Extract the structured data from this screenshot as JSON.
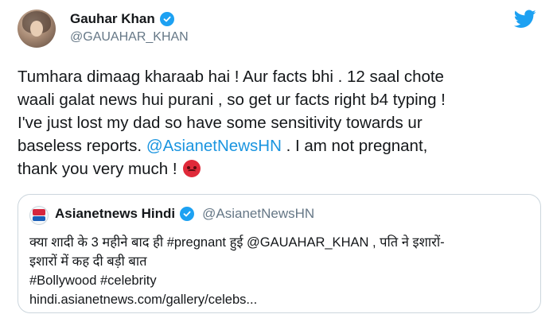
{
  "tweet": {
    "display_name": "Gauhar Khan",
    "handle": "@GAUAHAR_KHAN",
    "body_part1": "Tumhara dimaag kharaab hai ! Aur facts bhi . 12 saal chote\nwaali galat news hui purani , so get ur facts right b4 typing !\nI've just lost my dad so have some sensitivity towards ur\nbaseless reports. ",
    "body_mention": "@AsianetNewsHN",
    "body_part2": " . I am not pregnant,\nthank you very much ! ",
    "emoji_icon": "angry-face-icon"
  },
  "quote": {
    "display_name": "Asianetnews Hindi",
    "handle": "@AsianetNewsHN",
    "line1": "क्या शादी के 3 महीने बाद ही #pregnant  हुई @GAUAHAR_KHAN , पति ने इशारों-",
    "line2": "इशारों में कह दी बड़ी बात",
    "line3": "#Bollywood #celebrity",
    "line4": " hindi.asianetnews.com/gallery/celebs..."
  },
  "colors": {
    "twitter_blue": "#1da1f2",
    "link_blue": "#1b95e0",
    "muted_text": "#657786",
    "border": "#ccd6dd"
  }
}
